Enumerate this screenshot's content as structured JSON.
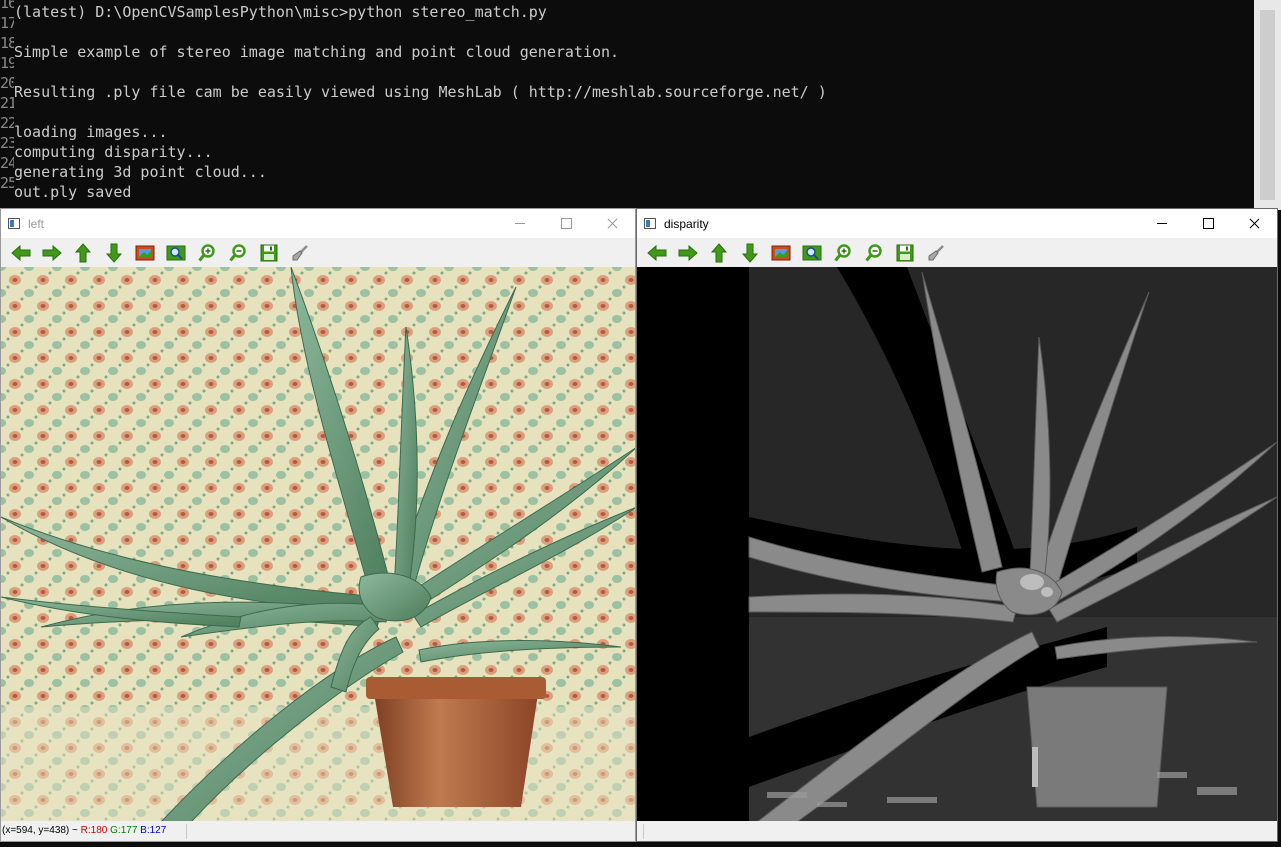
{
  "terminal": {
    "line_numbers": [
      "16",
      "17",
      "18",
      "19",
      "20",
      "21",
      "22",
      "23",
      "24",
      "25"
    ],
    "lines": [
      "(latest) D:\\OpenCVSamplesPython\\misc>python stereo_match.py",
      "",
      "Simple example of stereo image matching and point cloud generation.",
      "",
      "Resulting .ply file cam be easily viewed using MeshLab ( http://meshlab.sourceforge.net/ )",
      "",
      "loading images...",
      "computing disparity...",
      "generating 3d point cloud...",
      "out.ply saved"
    ]
  },
  "windows": {
    "left": {
      "title": "left",
      "status": {
        "coords": "(x=594, y=438) ~ ",
        "r": "R:180",
        "g": "G:177",
        "b": "B:127"
      }
    },
    "right": {
      "title": "disparity",
      "status": {
        "coords": "",
        "r": "",
        "g": "",
        "b": ""
      }
    }
  },
  "toolbar_icons": [
    "pan-left-icon",
    "pan-right-icon",
    "pan-up-icon",
    "pan-down-icon",
    "zoom-original-icon",
    "zoom-fit-icon",
    "zoom-in-icon",
    "zoom-out-icon",
    "save-icon",
    "properties-icon"
  ],
  "colors": {
    "terminal_bg": "#0c0c0c",
    "terminal_fg": "#cccccc",
    "toolbar_green": "#3f9a18",
    "window_bg": "#f0f0f0"
  }
}
